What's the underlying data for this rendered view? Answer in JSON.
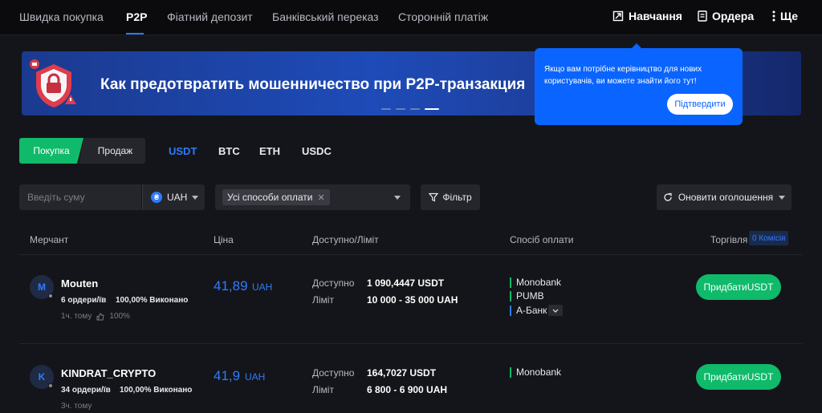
{
  "nav": {
    "items": [
      "Швидка покупка",
      "P2P",
      "Фіатний депозит",
      "Банківський переказ",
      "Сторонній платіж"
    ],
    "right": [
      "Навчання",
      "Ордера",
      "Ще"
    ]
  },
  "banner": {
    "title": "Как предотвратить мошенничество при P2P-транзакция",
    "slide_count": 4,
    "active_slide": 4
  },
  "tooltip": {
    "text": "Якщо вам потрібне керівництво для нових користувачів, ви можете знайти його тут!",
    "confirm": "Підтвердити"
  },
  "trade": {
    "buy": "Покупка",
    "sell": "Продаж",
    "coins": [
      "USDT",
      "BTC",
      "ETH",
      "USDC"
    ],
    "active_coin": "USDT"
  },
  "filters": {
    "amount_placeholder": "Введіть суму",
    "currency": "UAH",
    "currency_icon": "₴",
    "payment": "Усі способи оплати",
    "filter": "Фільтр",
    "refresh": "Оновити оголошення"
  },
  "table": {
    "headers": [
      "Мерчант",
      "Ціна",
      "Доступно/Ліміт",
      "Спосіб оплати",
      "Торгівля"
    ],
    "fee_badge": "0 Комісія",
    "available_label": "Доступно",
    "limit_label": "Ліміт",
    "rows": [
      {
        "initial": "M",
        "name": "Mouten",
        "orders": "6 ордери/їв",
        "completion": "100,00% Виконано",
        "time": "1ч. тому",
        "rating": "100%",
        "price": "41,89",
        "unit": "UAH",
        "available": "1 090,4447  USDT",
        "limit": "10 000 - 35 000 UAH",
        "payments": [
          "Monobank",
          "PUMB",
          "А-Банк"
        ],
        "buy": "ПридбатиUSDT"
      },
      {
        "initial": "K",
        "name": "KINDRAT_CRYPTO",
        "orders": "34 ордери/їв",
        "completion": "100,00% Виконано",
        "time": "3ч. тому",
        "price": "41,9",
        "unit": "UAH",
        "available": "164,7027  USDT",
        "limit": "6 800 - 6 900 UAH",
        "payments": [
          "Monobank"
        ],
        "buy": "ПридбатиUSDT"
      }
    ]
  },
  "colors": {
    "accent": "#2f7bff",
    "buy": "#0fba6a",
    "background": "#14151a",
    "tooltip": "#0a64ff"
  }
}
